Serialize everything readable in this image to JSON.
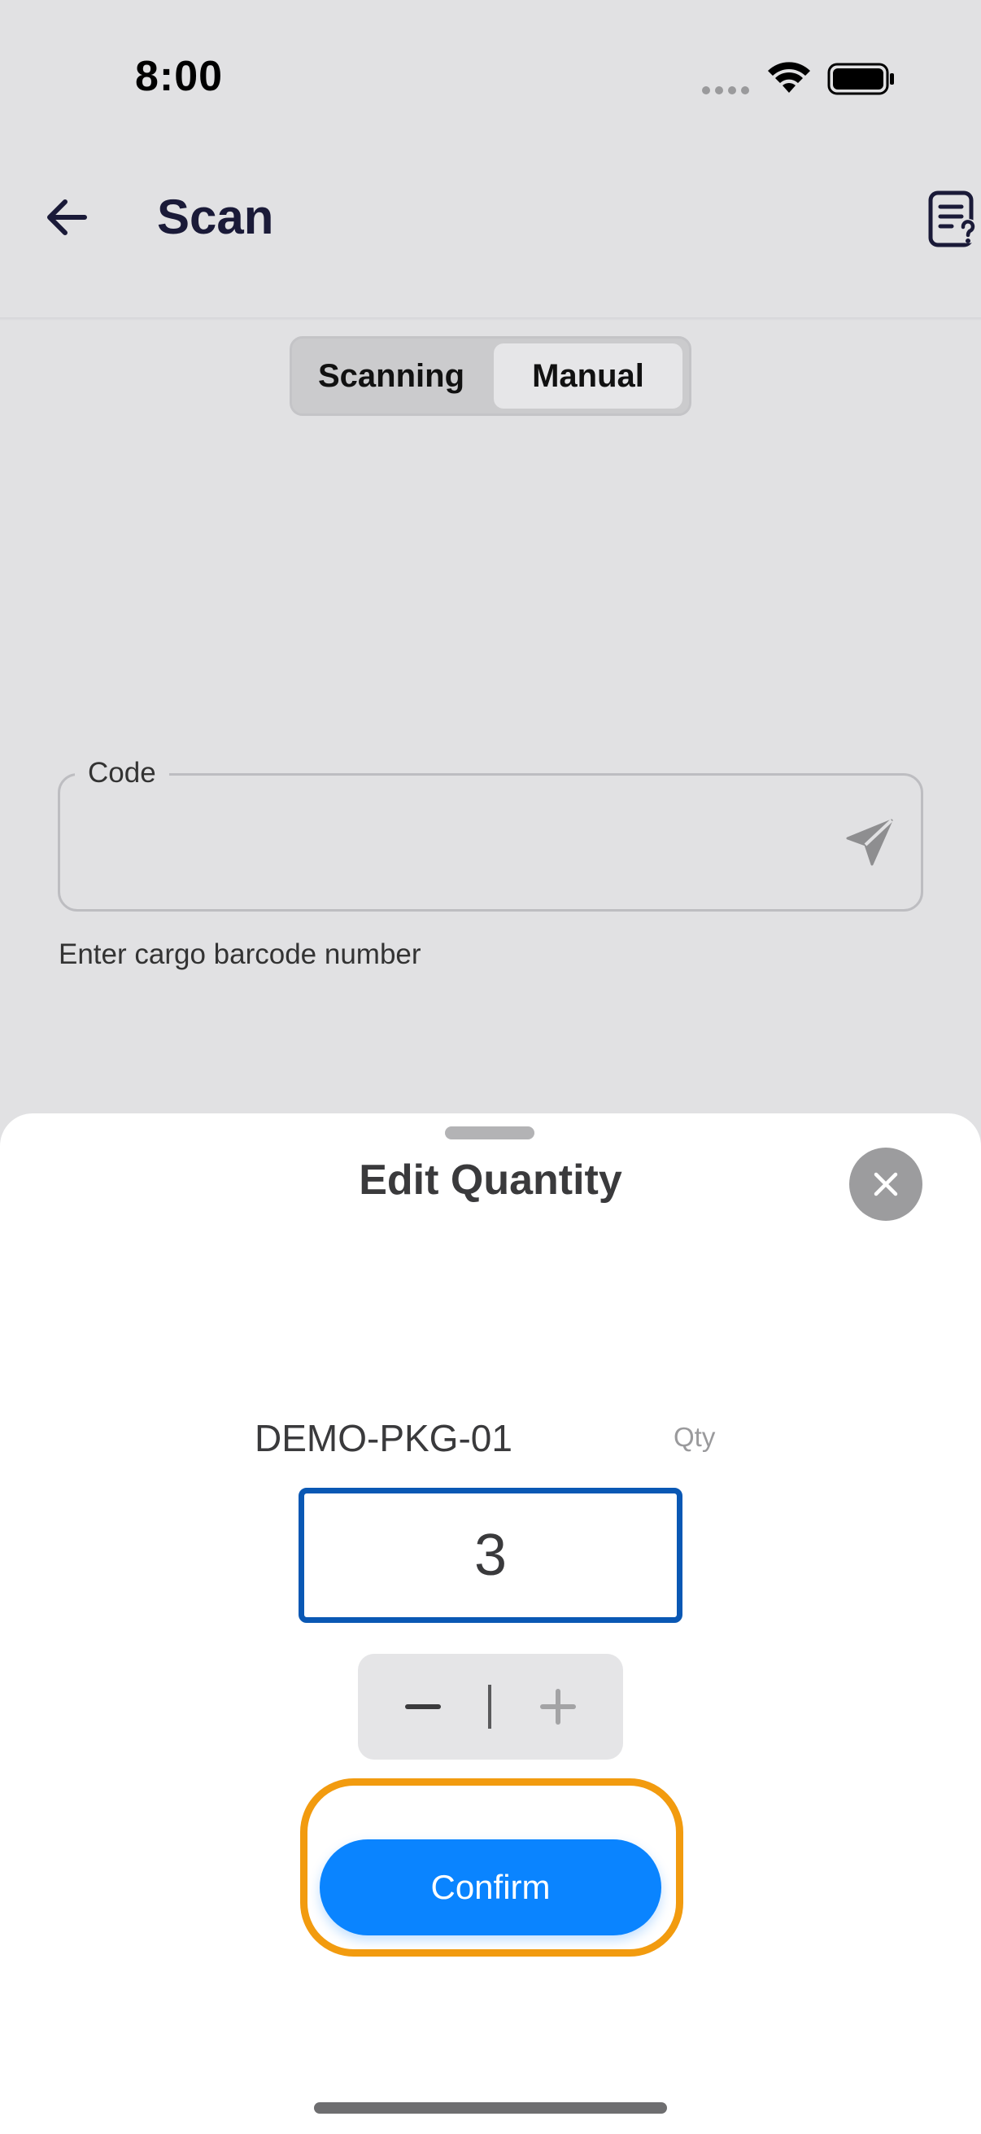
{
  "status_bar": {
    "time": "8:00"
  },
  "header": {
    "title": "Scan",
    "back_icon": "arrow-left-icon",
    "help_icon": "document-question-icon"
  },
  "segmented_control": {
    "options": [
      "Scanning",
      "Manual"
    ],
    "selected": "Manual"
  },
  "code_field": {
    "label": "Code",
    "value": "",
    "helper_text": "Enter cargo barcode number",
    "submit_icon": "send-icon"
  },
  "sheet": {
    "title": "Edit Quantity",
    "close_icon": "close-icon",
    "item_code": "DEMO-PKG-01",
    "qty_label": "Qty",
    "qty_value": "3",
    "decrement_icon": "minus-icon",
    "increment_icon": "plus-icon",
    "confirm_label": "Confirm"
  },
  "colors": {
    "accent": "#0a84ff",
    "highlight": "#f29b0f",
    "input_border": "#0a58b4",
    "backdrop": "#e1e1e3"
  }
}
